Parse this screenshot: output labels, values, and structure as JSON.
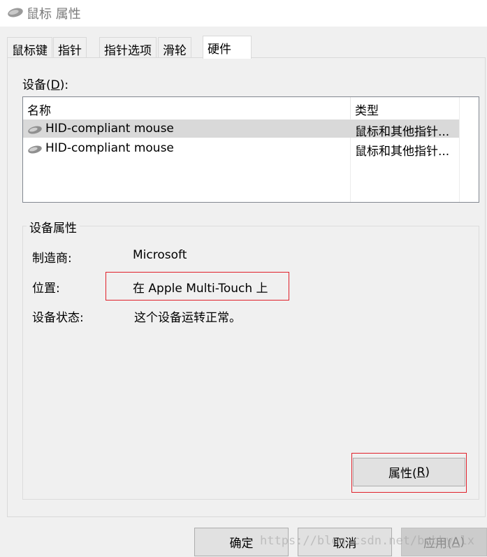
{
  "window": {
    "title": "鼠标 属性",
    "icon": "mouse-icon"
  },
  "tabs": [
    {
      "label": "鼠标键"
    },
    {
      "label": "指针"
    },
    {
      "label": "指针选项"
    },
    {
      "label": "滑轮"
    },
    {
      "label": "硬件",
      "active": true
    }
  ],
  "devices": {
    "label_prefix": "设备(",
    "label_mnemonic": "D",
    "label_suffix": "):",
    "columns": {
      "name": "名称",
      "type": "类型"
    },
    "rows": [
      {
        "name": "HID-compliant mouse",
        "type": "鼠标和其他指针...",
        "selected": true
      },
      {
        "name": "HID-compliant mouse",
        "type": "鼠标和其他指针...",
        "selected": false
      }
    ]
  },
  "properties": {
    "title": "设备属性",
    "manufacturer_label": "制造商:",
    "manufacturer_value": "Microsoft",
    "location_label": "位置:",
    "location_value": "在 Apple Multi-Touch 上",
    "status_label": "设备状态:",
    "status_value": "这个设备运转正常。",
    "properties_button_prefix": "属性(",
    "properties_button_mnemonic": "R",
    "properties_button_suffix": ")"
  },
  "footer": {
    "ok": "确定",
    "cancel": "取消",
    "apply_prefix": "应用(",
    "apply_mnemonic": "A",
    "apply_suffix": ")"
  },
  "watermark": "https://blog.csdn.net/bobby_lx",
  "colors": {
    "highlight_box": "#e0202a",
    "selected_row": "#d9d9d9"
  }
}
